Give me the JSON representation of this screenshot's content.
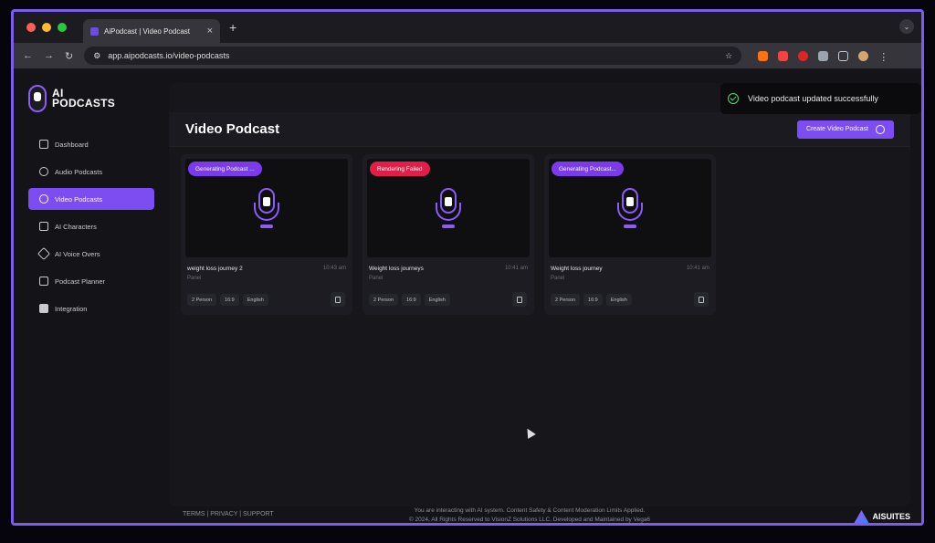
{
  "browser": {
    "tab_title": "AiPodcast | Video Podcast",
    "url": "app.aipodcasts.io/video-podcasts"
  },
  "logo": {
    "line1": "AI",
    "line2": "PODCASTS"
  },
  "sidebar": {
    "items": [
      {
        "label": "Dashboard",
        "icon": "grid-icon"
      },
      {
        "label": "Audio Podcasts",
        "icon": "mic-icon"
      },
      {
        "label": "Video Podcasts",
        "icon": "podcast-icon"
      },
      {
        "label": "AI Characters",
        "icon": "user-icon"
      },
      {
        "label": "AI Voice Overs",
        "icon": "wave-icon"
      },
      {
        "label": "Podcast Planner",
        "icon": "calendar-icon"
      },
      {
        "label": "Integration",
        "icon": "puzzle-icon"
      }
    ]
  },
  "page": {
    "title": "Video Podcast",
    "create_button": "Create Video Podcast"
  },
  "toast": {
    "message": "Video podcast updated successfully"
  },
  "cards": [
    {
      "status": "Generating Podcast ...",
      "status_color": "#7c3aed",
      "title": "weight loss journey 2",
      "time": "10:43 am",
      "sub": "Panel",
      "tags": [
        "2 Person",
        "16:9",
        "English"
      ]
    },
    {
      "status": "Rendering Failed",
      "status_color": "#e11d48",
      "title": "Weight loss journeys",
      "time": "10:41 am",
      "sub": "Panel",
      "tags": [
        "2 Person",
        "16:9",
        "English"
      ]
    },
    {
      "status": "Generating Podcast...",
      "status_color": "#7c3aed",
      "title": "Weight loss journey",
      "time": "10:41 am",
      "sub": "Panel",
      "tags": [
        "2 Person",
        "16:9",
        "English"
      ]
    }
  ],
  "footer": {
    "links": "TERMS  |  PRIVACY  |  SUPPORT",
    "notice": "You are interacting with AI system. Content Safety & Content Moderation Limits Applied.",
    "copyright": "© 2024, All Rights Reserved to VisionZ Solutions LLC. Developed and Maintained by Vega6",
    "brand": "AISUITES"
  },
  "colors": {
    "accent": "#7c4df2",
    "danger": "#e11d48",
    "success": "#4ade80"
  }
}
